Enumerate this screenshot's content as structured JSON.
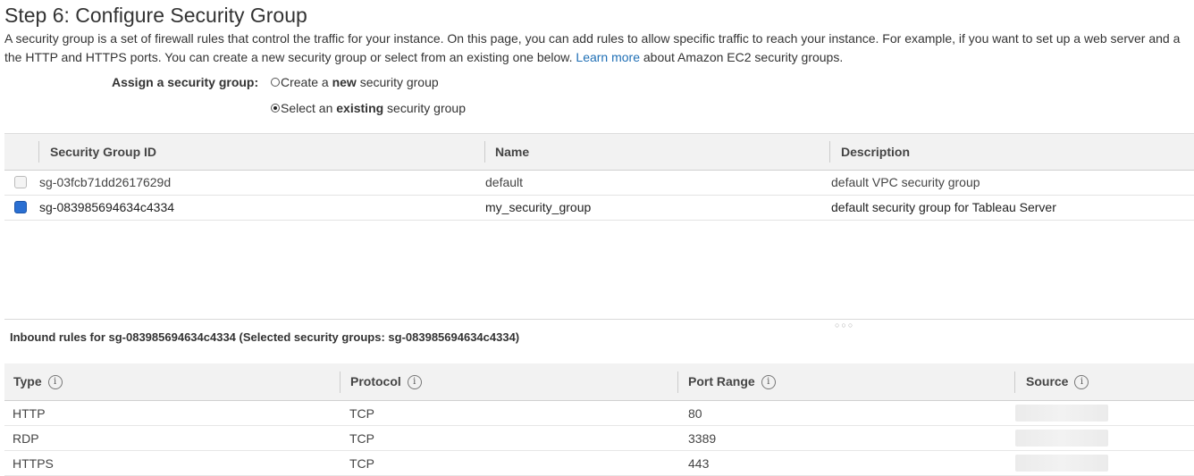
{
  "page": {
    "title": "Step 6: Configure Security Group",
    "intro_line1": "A security group is a set of firewall rules that control the traffic for your instance. On this page, you can add rules to allow specific traffic to reach your instance. For example, if you want to set up a web server and a",
    "intro_line2_before": "the HTTP and HTTPS ports. You can create a new security group or select from an existing one below. ",
    "learn_more": "Learn more",
    "intro_line2_after": " about Amazon EC2 security groups."
  },
  "assign": {
    "label": "Assign a security group:",
    "options": [
      {
        "before": "Create a ",
        "bold": "new",
        "after": " security group",
        "selected": false
      },
      {
        "before": "Select an ",
        "bold": "existing",
        "after": " security group",
        "selected": true
      }
    ]
  },
  "security_groups": {
    "columns": [
      "Security Group ID",
      "Name",
      "Description"
    ],
    "rows": [
      {
        "id": "sg-03fcb71dd2617629d",
        "name": "default",
        "description": "default VPC security group",
        "checked": false
      },
      {
        "id": "sg-083985694634c4334",
        "name": "my_security_group",
        "description": "default security group for Tableau Server",
        "checked": true
      }
    ]
  },
  "inbound": {
    "title": "Inbound rules for sg-083985694634c4334 (Selected security groups: sg-083985694634c4334)",
    "columns": [
      "Type",
      "Protocol",
      "Port Range",
      "Source"
    ],
    "info_glyph": "i",
    "rows": [
      {
        "type": "HTTP",
        "protocol": "TCP",
        "port": "80",
        "source": ""
      },
      {
        "type": "RDP",
        "protocol": "TCP",
        "port": "3389",
        "source": ""
      },
      {
        "type": "HTTPS",
        "protocol": "TCP",
        "port": "443",
        "source": ""
      }
    ]
  },
  "colors": {
    "accent": "#2a6fd2",
    "link": "#1f6fb5",
    "header_bg": "#f2f2f2"
  },
  "icons": {
    "info": "info-icon",
    "resize": "resize-grip-icon"
  }
}
